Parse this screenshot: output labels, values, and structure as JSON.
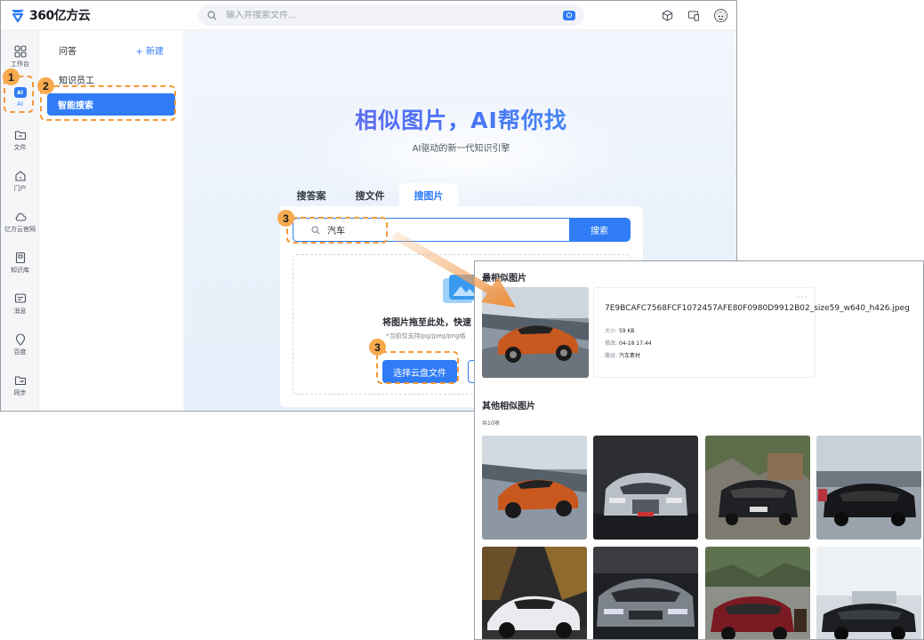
{
  "app": {
    "logo_text": "360亿方云",
    "search_placeholder": "输入并搜索文件...",
    "brand_color": "#2f7cf6",
    "accent_annotation_color": "#f39a3a"
  },
  "nav": {
    "items": [
      {
        "label": "工作台",
        "icon": "grid-icon"
      },
      {
        "label": "AI",
        "icon": "ai-icon"
      },
      {
        "label": "文件",
        "icon": "folder-icon"
      },
      {
        "label": "门户",
        "icon": "home-icon"
      },
      {
        "label": "亿方云官网",
        "icon": "cloud-icon"
      },
      {
        "label": "知识库",
        "icon": "book-icon"
      },
      {
        "label": "消息",
        "icon": "message-icon"
      },
      {
        "label": "百度",
        "icon": "location-icon"
      },
      {
        "label": "同步",
        "icon": "sync-folder-icon"
      }
    ]
  },
  "panel": {
    "heading": "问答",
    "new_label": "+ 新建",
    "item_1": "知识员工",
    "item_selected": "智能搜索"
  },
  "hero": {
    "title": "相似图片，AI帮你找",
    "subtitle": "AI驱动的新一代知识引擎"
  },
  "tabs": [
    "搜答案",
    "搜文件",
    "搜图片"
  ],
  "image_search": {
    "query": "汽车",
    "search_button": "搜索",
    "drop_text": "将图片拖至此处，快速",
    "drop_note": "*当前仅支持jpg/jpeg/png格",
    "choose_button": "选择云盘文件"
  },
  "annotations": {
    "step1": "1",
    "step2": "2",
    "step3a": "3",
    "step3b": "3"
  },
  "result": {
    "best_heading": "最相似图片",
    "more": "···",
    "file_name": "7E9BCAFC7568FCF1072457AFE80F0980D9912B02_size59_w640_h426.jpeg",
    "size_label": "大小:",
    "size_value": "59 KB",
    "modified_label": "修改:",
    "modified_value": "04-18 17:44",
    "path_label": "路径:",
    "path_value": "汽车素材",
    "others_heading": "其他相似图片",
    "count": "共10项"
  }
}
